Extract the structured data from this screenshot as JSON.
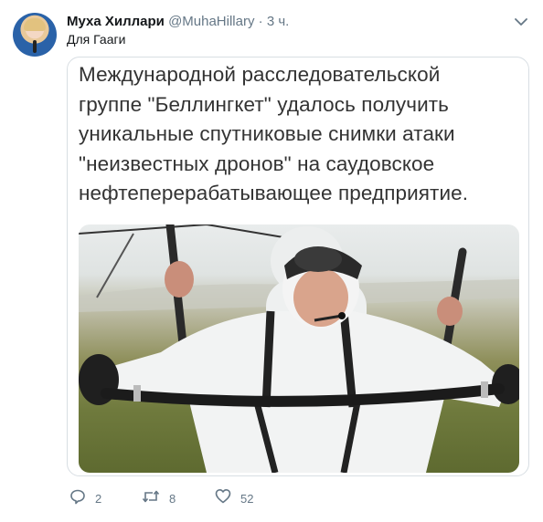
{
  "author": {
    "name": "Муха Хиллари",
    "handle": "@MuhaHillary",
    "separator": "·",
    "time": "3 ч."
  },
  "reply_to": "Для Гааги",
  "card": {
    "text_lines": [
      "Международной расследовательской",
      "группе \"Беллингкет\" удалось получить",
      "уникальные спутниковые снимки атаки",
      "\"неизвестных дронов\" на саудовское",
      "нефтеперерабатывающее предприятие."
    ]
  },
  "actions": {
    "reply_count": "2",
    "retweet_count": "8",
    "like_count": "52"
  },
  "icons": {
    "menu": "chevron-down-icon",
    "reply": "reply-icon",
    "retweet": "retweet-icon",
    "like": "heart-icon"
  },
  "colors": {
    "secondary_text": "#657786",
    "primary_text": "#14171a",
    "border": "#d8dee3"
  }
}
